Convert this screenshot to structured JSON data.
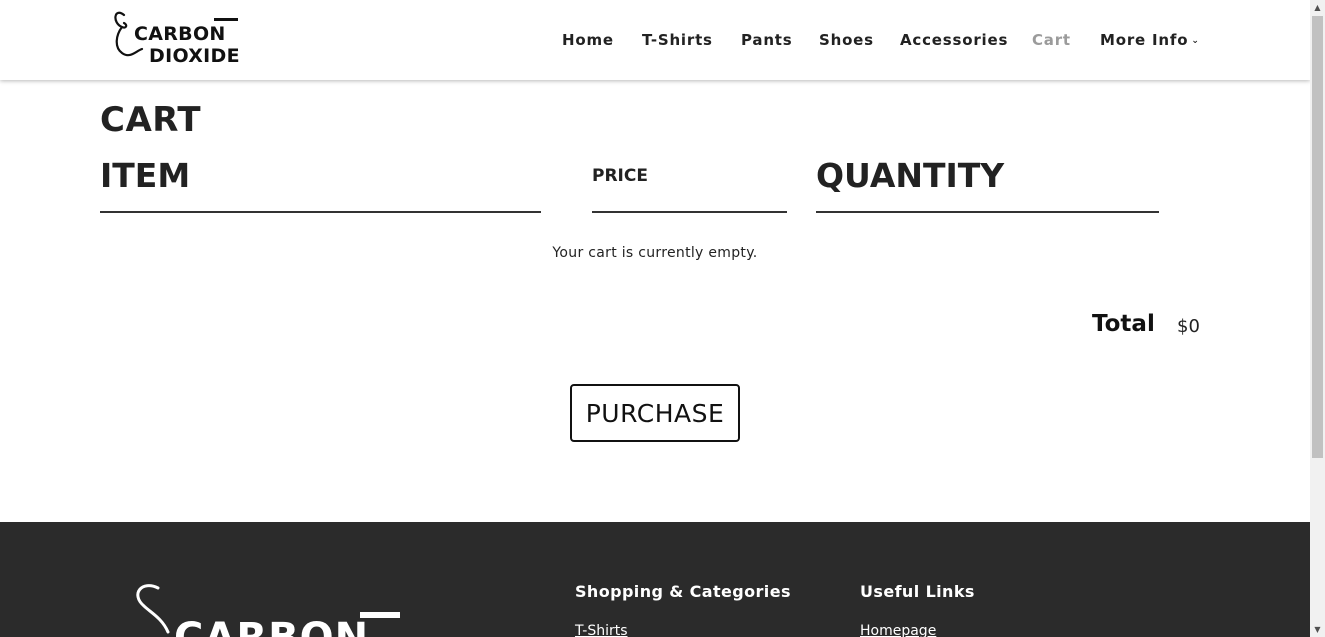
{
  "brand": {
    "logo_line1": "CARBON",
    "logo_line2": "DIOXIDE",
    "colors": {
      "text": "#222222",
      "nav_active": "#9b9b9b",
      "footer_bg": "#2b2b2b",
      "button_border": "#111111"
    }
  },
  "nav": {
    "items": [
      {
        "label": "Home",
        "active": false
      },
      {
        "label": "T-Shirts",
        "active": false
      },
      {
        "label": "Pants",
        "active": false
      },
      {
        "label": "Shoes",
        "active": false
      },
      {
        "label": "Accessories",
        "active": false
      },
      {
        "label": "Cart",
        "active": true
      },
      {
        "label": "More Info",
        "active": false,
        "icon": "chevron-down-icon"
      }
    ]
  },
  "cart": {
    "title": "CART",
    "columns": {
      "item": "ITEM",
      "price": "PRICE",
      "quantity": "QUANTITY"
    },
    "empty_message": "Your cart is currently empty.",
    "total_label": "Total",
    "total_value": "$0",
    "purchase_label": "PURCHASE"
  },
  "footer": {
    "logo_text": "CARBON",
    "shopping_heading": "Shopping & Categories",
    "shopping_link": "T-Shirts",
    "useful_heading": "Useful Links",
    "useful_link": "Homepage"
  }
}
